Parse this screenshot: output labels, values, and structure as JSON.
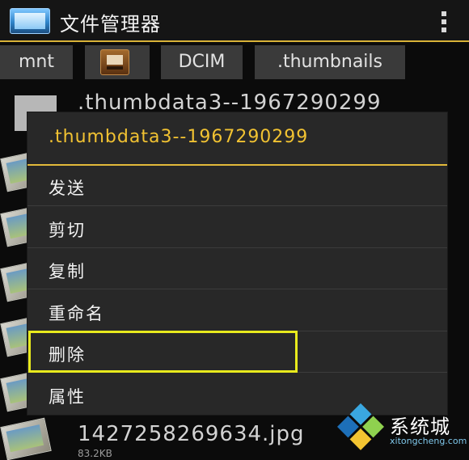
{
  "app": {
    "title": "文件管理器"
  },
  "breadcrumbs": [
    {
      "label": "mnt"
    },
    {
      "label": "",
      "icon": "sdcard-icon"
    },
    {
      "label": "DCIM"
    },
    {
      "label": ".thumbnails"
    }
  ],
  "files": {
    "first_name": ".thumbdata3--1967290299",
    "last_name": "1427258269634.jpg",
    "last_sub": "83.2KB"
  },
  "dialog": {
    "title": ".thumbdata3--1967290299",
    "items": [
      {
        "label": "发送"
      },
      {
        "label": "剪切"
      },
      {
        "label": "复制"
      },
      {
        "label": "重命名"
      },
      {
        "label": "删除"
      },
      {
        "label": "属性"
      }
    ],
    "highlighted_item": "删除"
  },
  "watermark": {
    "text": "系统城",
    "url": "xitongcheng.com"
  },
  "colors": {
    "accent": "#e2b93a",
    "highlight_box": "#e8ea1d",
    "background": "#0b0b0b"
  }
}
